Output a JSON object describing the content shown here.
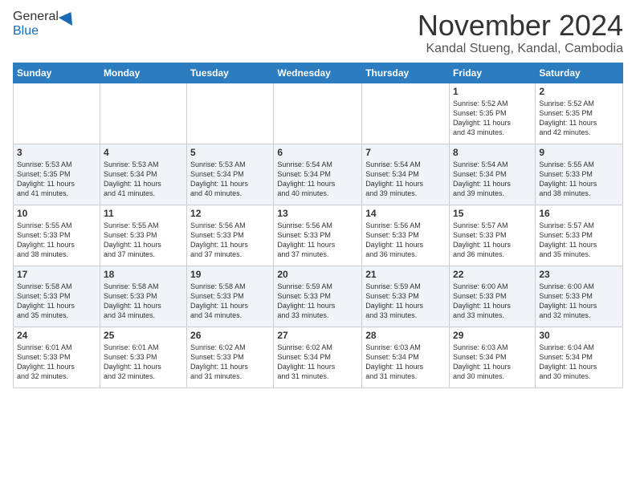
{
  "logo": {
    "general": "General",
    "blue": "Blue"
  },
  "header": {
    "month": "November 2024",
    "location": "Kandal Stueng, Kandal, Cambodia"
  },
  "weekdays": [
    "Sunday",
    "Monday",
    "Tuesday",
    "Wednesday",
    "Thursday",
    "Friday",
    "Saturday"
  ],
  "weeks": [
    [
      {
        "day": "",
        "info": ""
      },
      {
        "day": "",
        "info": ""
      },
      {
        "day": "",
        "info": ""
      },
      {
        "day": "",
        "info": ""
      },
      {
        "day": "",
        "info": ""
      },
      {
        "day": "1",
        "info": "Sunrise: 5:52 AM\nSunset: 5:35 PM\nDaylight: 11 hours\nand 43 minutes."
      },
      {
        "day": "2",
        "info": "Sunrise: 5:52 AM\nSunset: 5:35 PM\nDaylight: 11 hours\nand 42 minutes."
      }
    ],
    [
      {
        "day": "3",
        "info": "Sunrise: 5:53 AM\nSunset: 5:35 PM\nDaylight: 11 hours\nand 41 minutes."
      },
      {
        "day": "4",
        "info": "Sunrise: 5:53 AM\nSunset: 5:34 PM\nDaylight: 11 hours\nand 41 minutes."
      },
      {
        "day": "5",
        "info": "Sunrise: 5:53 AM\nSunset: 5:34 PM\nDaylight: 11 hours\nand 40 minutes."
      },
      {
        "day": "6",
        "info": "Sunrise: 5:54 AM\nSunset: 5:34 PM\nDaylight: 11 hours\nand 40 minutes."
      },
      {
        "day": "7",
        "info": "Sunrise: 5:54 AM\nSunset: 5:34 PM\nDaylight: 11 hours\nand 39 minutes."
      },
      {
        "day": "8",
        "info": "Sunrise: 5:54 AM\nSunset: 5:34 PM\nDaylight: 11 hours\nand 39 minutes."
      },
      {
        "day": "9",
        "info": "Sunrise: 5:55 AM\nSunset: 5:33 PM\nDaylight: 11 hours\nand 38 minutes."
      }
    ],
    [
      {
        "day": "10",
        "info": "Sunrise: 5:55 AM\nSunset: 5:33 PM\nDaylight: 11 hours\nand 38 minutes."
      },
      {
        "day": "11",
        "info": "Sunrise: 5:55 AM\nSunset: 5:33 PM\nDaylight: 11 hours\nand 37 minutes."
      },
      {
        "day": "12",
        "info": "Sunrise: 5:56 AM\nSunset: 5:33 PM\nDaylight: 11 hours\nand 37 minutes."
      },
      {
        "day": "13",
        "info": "Sunrise: 5:56 AM\nSunset: 5:33 PM\nDaylight: 11 hours\nand 37 minutes."
      },
      {
        "day": "14",
        "info": "Sunrise: 5:56 AM\nSunset: 5:33 PM\nDaylight: 11 hours\nand 36 minutes."
      },
      {
        "day": "15",
        "info": "Sunrise: 5:57 AM\nSunset: 5:33 PM\nDaylight: 11 hours\nand 36 minutes."
      },
      {
        "day": "16",
        "info": "Sunrise: 5:57 AM\nSunset: 5:33 PM\nDaylight: 11 hours\nand 35 minutes."
      }
    ],
    [
      {
        "day": "17",
        "info": "Sunrise: 5:58 AM\nSunset: 5:33 PM\nDaylight: 11 hours\nand 35 minutes."
      },
      {
        "day": "18",
        "info": "Sunrise: 5:58 AM\nSunset: 5:33 PM\nDaylight: 11 hours\nand 34 minutes."
      },
      {
        "day": "19",
        "info": "Sunrise: 5:58 AM\nSunset: 5:33 PM\nDaylight: 11 hours\nand 34 minutes."
      },
      {
        "day": "20",
        "info": "Sunrise: 5:59 AM\nSunset: 5:33 PM\nDaylight: 11 hours\nand 33 minutes."
      },
      {
        "day": "21",
        "info": "Sunrise: 5:59 AM\nSunset: 5:33 PM\nDaylight: 11 hours\nand 33 minutes."
      },
      {
        "day": "22",
        "info": "Sunrise: 6:00 AM\nSunset: 5:33 PM\nDaylight: 11 hours\nand 33 minutes."
      },
      {
        "day": "23",
        "info": "Sunrise: 6:00 AM\nSunset: 5:33 PM\nDaylight: 11 hours\nand 32 minutes."
      }
    ],
    [
      {
        "day": "24",
        "info": "Sunrise: 6:01 AM\nSunset: 5:33 PM\nDaylight: 11 hours\nand 32 minutes."
      },
      {
        "day": "25",
        "info": "Sunrise: 6:01 AM\nSunset: 5:33 PM\nDaylight: 11 hours\nand 32 minutes."
      },
      {
        "day": "26",
        "info": "Sunrise: 6:02 AM\nSunset: 5:33 PM\nDaylight: 11 hours\nand 31 minutes."
      },
      {
        "day": "27",
        "info": "Sunrise: 6:02 AM\nSunset: 5:34 PM\nDaylight: 11 hours\nand 31 minutes."
      },
      {
        "day": "28",
        "info": "Sunrise: 6:03 AM\nSunset: 5:34 PM\nDaylight: 11 hours\nand 31 minutes."
      },
      {
        "day": "29",
        "info": "Sunrise: 6:03 AM\nSunset: 5:34 PM\nDaylight: 11 hours\nand 30 minutes."
      },
      {
        "day": "30",
        "info": "Sunrise: 6:04 AM\nSunset: 5:34 PM\nDaylight: 11 hours\nand 30 minutes."
      }
    ]
  ]
}
